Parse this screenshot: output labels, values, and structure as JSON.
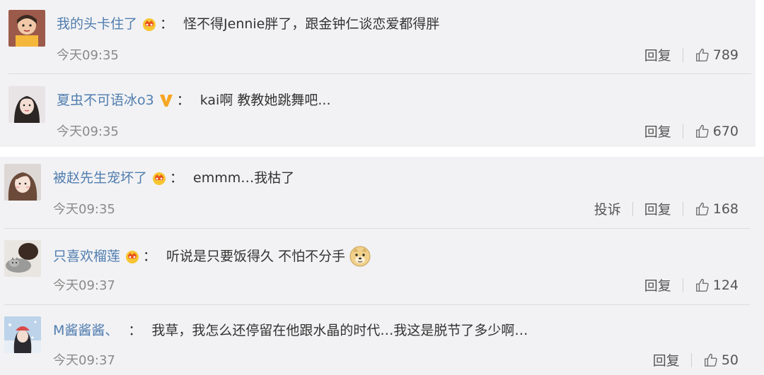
{
  "comments": [
    {
      "username": "我的头卡住了",
      "badge": "crown-icon",
      "text": "怪不得Jennie胖了，跟金钟仁谈恋爱都得胖",
      "time": "今天09:35",
      "actions": [
        "回复"
      ],
      "likes": "789"
    },
    {
      "username": "夏虫不可语冰o3",
      "badge": "v-badge-icon",
      "text": "kai啊 教教她跳舞吧...",
      "time": "今天09:35",
      "actions": [
        "回复"
      ],
      "likes": "670"
    },
    {
      "username": "被赵先生宠坏了",
      "badge": "crown-icon",
      "text": "emmm…我枯了",
      "time": "今天09:35",
      "actions": [
        "投诉",
        "回复"
      ],
      "likes": "168"
    },
    {
      "username": "只喜欢榴莲",
      "badge": "crown-icon",
      "text": "听说是只要饭得久 不怕不分手",
      "emoji": "doge-emoji",
      "time": "今天09:37",
      "actions": [
        "回复"
      ],
      "likes": "124"
    },
    {
      "username": "M酱酱酱、",
      "badge": "",
      "text": "我草，我怎么还停留在他跟水晶的时代…我这是脱节了多少啊…",
      "time": "今天09:37",
      "actions": [
        "回复"
      ],
      "likes": "50"
    }
  ],
  "colon": "："
}
